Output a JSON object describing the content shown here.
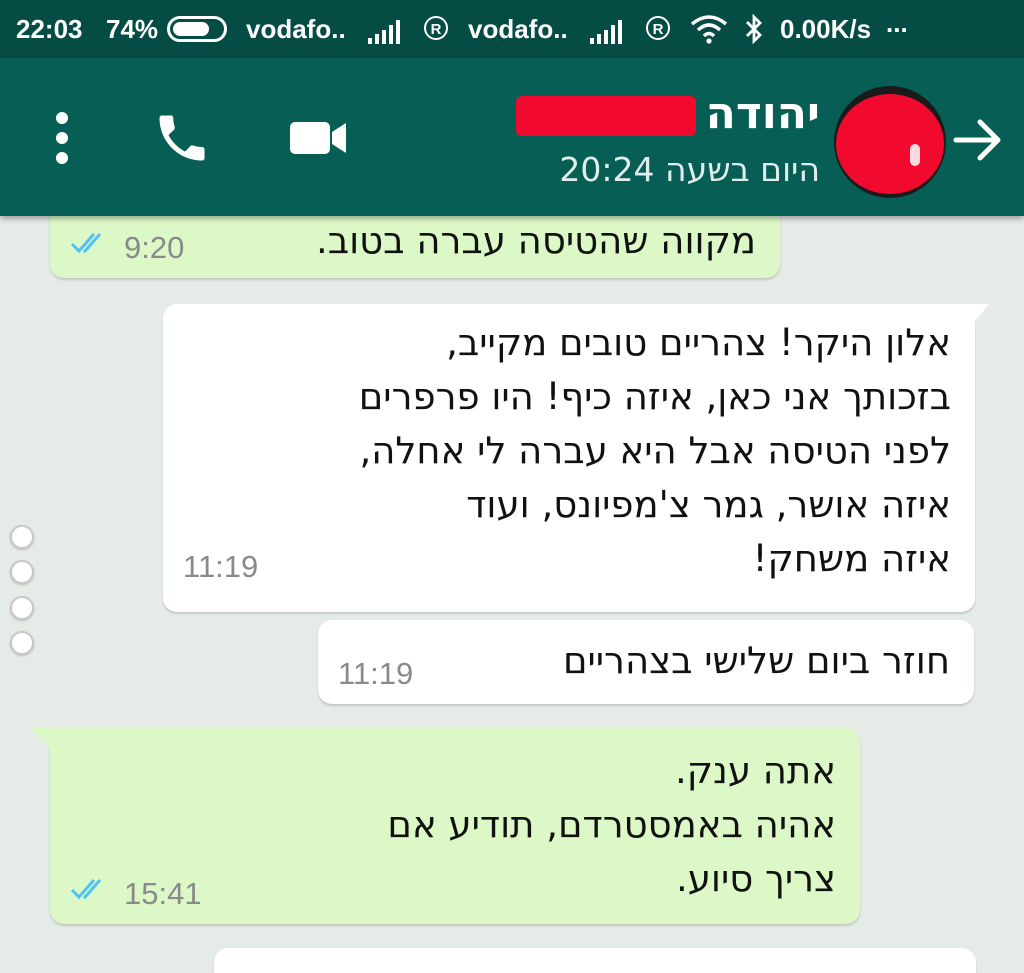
{
  "status_bar": {
    "time": "22:03",
    "battery_percent": "74%",
    "battery_level": 0.74,
    "carrier_1": "vodafo..",
    "carrier_2": "vodafo..",
    "roaming_mark": "R",
    "data_rate": "0.00K/s",
    "more": "..."
  },
  "header": {
    "contact_name": "יהודה",
    "last_seen": "היום בשעה 20:24",
    "icons": [
      "more-vert-icon",
      "phone-icon",
      "video-call-icon",
      "avatar",
      "forward-arrow-icon"
    ]
  },
  "messages": [
    {
      "direction": "outgoing",
      "text": "מקווה שהטיסה עברה בטוב.",
      "time": "9:20",
      "read": true
    },
    {
      "direction": "incoming",
      "text": "אלון היקר!  צהריים טובים מקייב,\nבזכותך אני כאן, איזה כיף! היו פרפרים\nלפני הטיסה אבל היא עברה לי אחלה,\nאיזה אושר, גמר צ'מפיונס, ועוד\nאיזה משחק!",
      "time": "11:19"
    },
    {
      "direction": "incoming",
      "text": "חוזר ביום שלישי בצהריים",
      "time": "11:19"
    },
    {
      "direction": "outgoing",
      "text": "אתה ענק.\nאהיה באמסטרדם, תודיע אם\nצריך סיוע.",
      "time": "15:41",
      "read": true
    }
  ],
  "colors": {
    "status_bar": "#054d44",
    "toolbar": "#075e54",
    "chat_background": "#e5ebe6",
    "outgoing_bubble": "#dcf8c6",
    "incoming_bubble": "#ffffff",
    "read_ticks": "#4fc3f7",
    "redaction": "#f20a2e"
  }
}
